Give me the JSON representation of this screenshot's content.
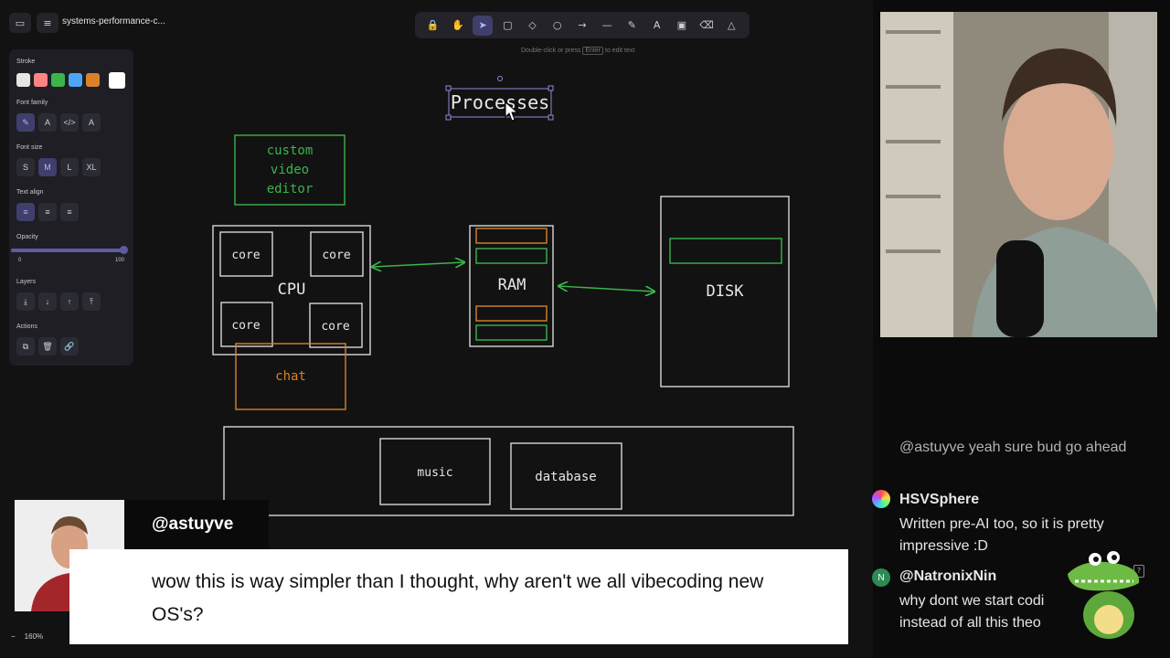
{
  "app": {
    "file_title": "systems-performance-c...",
    "hint_prefix": "Double-click or press",
    "hint_key": "Enter",
    "hint_suffix": "to edit text",
    "zoom": "160%",
    "zoom_minus": "−"
  },
  "toolbar": {
    "tools": [
      {
        "name": "lock-icon",
        "glyph": "🔒"
      },
      {
        "name": "hand-icon",
        "glyph": "✋"
      },
      {
        "name": "selection-icon",
        "glyph": "➤",
        "active": true
      },
      {
        "name": "rectangle-icon",
        "glyph": "▢"
      },
      {
        "name": "diamond-icon",
        "glyph": "◇"
      },
      {
        "name": "ellipse-icon",
        "glyph": "○"
      },
      {
        "name": "arrow-icon",
        "glyph": "→"
      },
      {
        "name": "line-icon",
        "glyph": "—"
      },
      {
        "name": "pencil-icon",
        "glyph": "✎"
      },
      {
        "name": "text-icon",
        "glyph": "A"
      },
      {
        "name": "image-icon",
        "glyph": "▣"
      },
      {
        "name": "eraser-icon",
        "glyph": "⌫"
      },
      {
        "name": "shapes-icon",
        "glyph": "△"
      }
    ]
  },
  "panel": {
    "stroke_label": "Stroke",
    "stroke_colors": [
      "#e5e5e5",
      "#ff8383",
      "#3bb44c",
      "#4ea5f5",
      "#d9822b",
      "#ffffff"
    ],
    "font_family_label": "Font family",
    "font_families": [
      {
        "name": "font-hand-icon",
        "glyph": "✎",
        "active": true
      },
      {
        "name": "font-normal-icon",
        "glyph": "A"
      },
      {
        "name": "font-code-icon",
        "glyph": "</>"
      },
      {
        "name": "font-other-icon",
        "glyph": "A"
      }
    ],
    "font_size_label": "Font size",
    "font_sizes": [
      {
        "label": "S"
      },
      {
        "label": "M",
        "active": true
      },
      {
        "label": "L"
      },
      {
        "label": "XL"
      }
    ],
    "text_align_label": "Text align",
    "text_aligns": [
      {
        "name": "align-left-icon",
        "glyph": "≡",
        "active": true
      },
      {
        "name": "align-center-icon",
        "glyph": "≡"
      },
      {
        "name": "align-right-icon",
        "glyph": "≡"
      }
    ],
    "opacity_label": "Opacity",
    "opacity_min": "0",
    "opacity_max": "100",
    "opacity_value": 100,
    "layers_label": "Layers",
    "layers": [
      {
        "name": "send-to-back-icon",
        "glyph": "⤓"
      },
      {
        "name": "send-backward-icon",
        "glyph": "↓"
      },
      {
        "name": "bring-forward-icon",
        "glyph": "↑"
      },
      {
        "name": "bring-to-front-icon",
        "glyph": "⤒"
      }
    ],
    "actions_label": "Actions",
    "actions": [
      {
        "name": "duplicate-icon",
        "glyph": "⧉"
      },
      {
        "name": "delete-icon",
        "glyph": "🗑"
      },
      {
        "name": "link-icon",
        "glyph": "🔗"
      }
    ]
  },
  "diagram": {
    "processes": "Processes",
    "custom_video_editor": [
      "custom",
      "video",
      "editor"
    ],
    "cpu": "CPU",
    "core": "core",
    "chat": "chat",
    "ram": "RAM",
    "disk": "DISK",
    "music": "music",
    "database": "database",
    "colors": {
      "white": "#d8d8d8",
      "green": "#3bb44c",
      "orange": "#d9822b"
    }
  },
  "chat": {
    "faded_message": "@astuyve yeah sure bud go ahead",
    "messages": [
      {
        "user": "HSVSphere",
        "text": "Written pre-AI too, so it is pretty impressive :D"
      },
      {
        "user": "@NatronixNin",
        "text": "why dont we start codi instead of all this theo"
      }
    ]
  },
  "highlight": {
    "user": "@astuyve",
    "message": "wow this is way simpler than I thought, why aren't we all vibecoding new OS's?"
  }
}
